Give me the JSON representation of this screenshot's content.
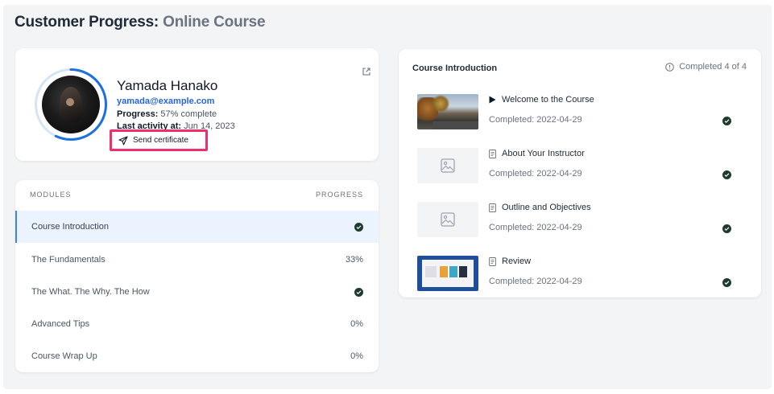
{
  "page": {
    "title": "Customer Progress:",
    "subtitle": "Online Course"
  },
  "profile": {
    "name": "Yamada Hanako",
    "email": "yamada@example.com",
    "progress_label": "Progress:",
    "progress_value": "57% complete",
    "progress_ring": 0.57,
    "activity_label": "Last activity at:",
    "activity_value": "Jun 14, 2023",
    "send_certificate_label": "Send certificate",
    "colors": {
      "ring": "#1e6fe0",
      "ring_track": "#d6e4f5",
      "highlight": "#ef2f6b"
    }
  },
  "modules": {
    "header_left": "MODULES",
    "header_right": "PROGRESS",
    "items": [
      {
        "label": "Course Introduction",
        "progress": "",
        "complete": true
      },
      {
        "label": "The Fundamentals",
        "progress": "33%",
        "complete": false
      },
      {
        "label": "The What. The Why. The How",
        "progress": "",
        "complete": true
      },
      {
        "label": "Advanced Tips",
        "progress": "0%",
        "complete": false
      },
      {
        "label": "Course Wrap Up",
        "progress": "0%",
        "complete": false
      }
    ]
  },
  "lessons": {
    "title": "Course Introduction",
    "status": "Completed 4 of 4",
    "items": [
      {
        "title": "Welcome to the Course",
        "date": "Completed: 2022-04-29",
        "icon": "play-icon"
      },
      {
        "title": "About Your Instructor",
        "date": "Completed: 2022-04-29",
        "icon": "document-icon"
      },
      {
        "title": "Outline and Objectives",
        "date": "Completed: 2022-04-29",
        "icon": "document-icon"
      },
      {
        "title": "Review",
        "date": "Completed: 2022-04-29",
        "icon": "document-icon"
      }
    ]
  }
}
